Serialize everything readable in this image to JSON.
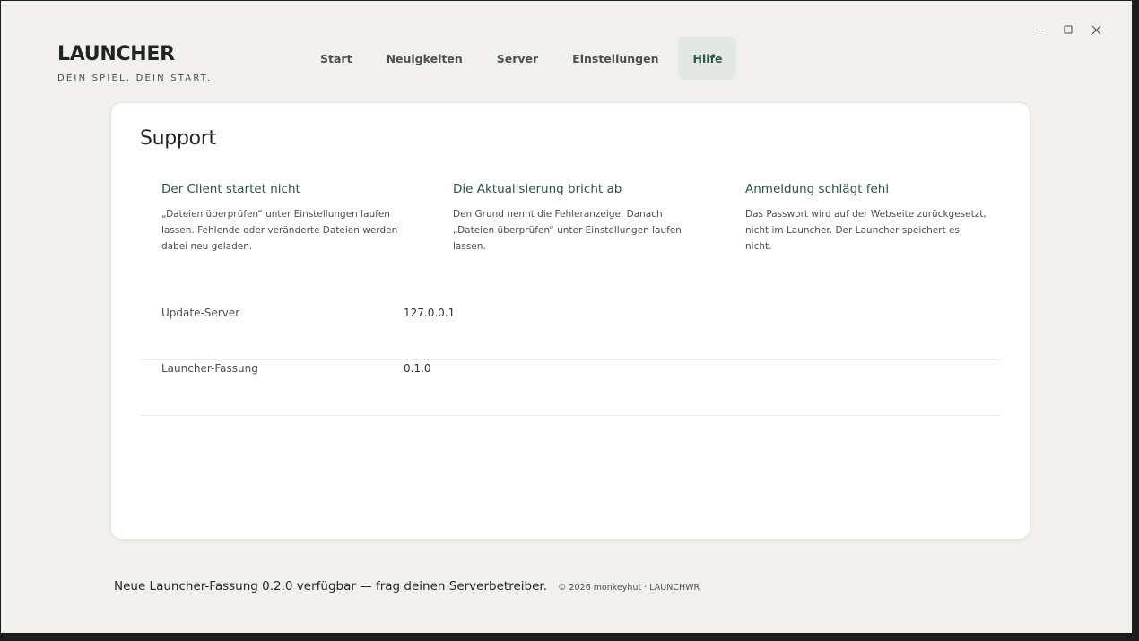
{
  "window": {
    "controls": {
      "minimize": "–",
      "maximize": "□",
      "close": "✕"
    }
  },
  "brand": {
    "title": "LAUNCHER",
    "tagline": "DEIN SPIEL. DEIN START."
  },
  "nav": {
    "items": [
      {
        "label": "Start",
        "active": false
      },
      {
        "label": "Neuigkeiten",
        "active": false
      },
      {
        "label": "Server",
        "active": false
      },
      {
        "label": "Einstellungen",
        "active": false
      },
      {
        "label": "Hilfe",
        "active": true
      }
    ]
  },
  "support": {
    "title": "Support",
    "faq": [
      {
        "question": "Der Client startet nicht",
        "answer": "„Dateien überprüfen“ unter Einstellungen laufen lassen. Fehlende oder veränderte Dateien werden dabei neu geladen."
      },
      {
        "question": "Die Aktualisierung bricht ab",
        "answer": "Den Grund nennt die Fehleranzeige. Danach „Dateien überprüfen“ unter Einstellungen laufen lassen."
      },
      {
        "question": "Anmeldung schlägt fehl",
        "answer": "Das Passwort wird auf der Webseite zurückgesetzt, nicht im Launcher. Der Launcher speichert es nicht."
      }
    ],
    "info": [
      {
        "label": "Update-Server",
        "value": "127.0.0.1"
      },
      {
        "label": "Launcher-Fassung",
        "value": "0.1.0"
      }
    ]
  },
  "footer": {
    "notice": "Neue Launcher-Fassung 0.2.0 verfügbar — frag deinen Serverbetreiber.",
    "copyright": "© 2026 monkeyhut · LAUNCHWR"
  },
  "colors": {
    "background": "#f1f0ec",
    "card": "#ffffff",
    "accent": "#2d5441",
    "nav_active_bg": "#e3e8e2"
  }
}
